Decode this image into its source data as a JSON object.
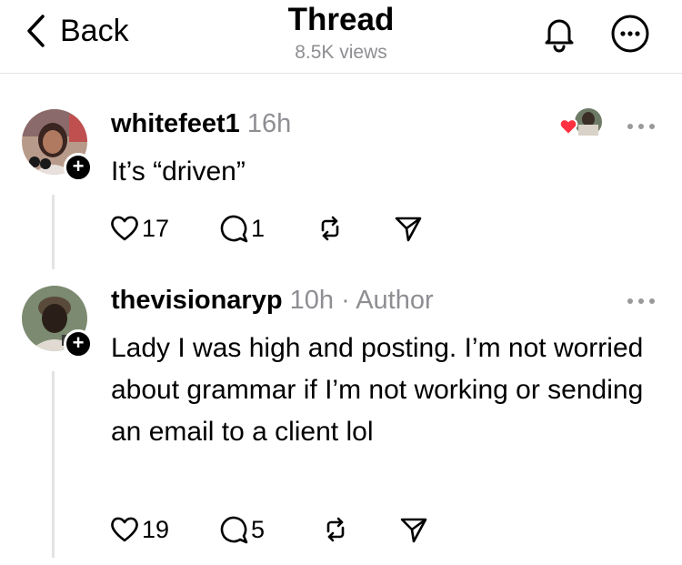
{
  "header": {
    "back_label": "Back",
    "title": "Thread",
    "views": "8.5K views"
  },
  "posts": [
    {
      "username": "whitefeet1",
      "time": "16h",
      "author_tag": "",
      "text": "It’s “driven”",
      "likes": "17",
      "replies": "1"
    },
    {
      "username": "thevisionaryp",
      "time": "10h",
      "author_tag": "· Author",
      "text": "Lady I was high and posting. I’m not worried about grammar if I’m not working or sending an email to a client lol",
      "likes": "19",
      "replies": "5"
    }
  ],
  "colors": {
    "heart": "#ff3040",
    "muted": "#8e8e93"
  },
  "icons": [
    "chevron-left-icon",
    "bell-icon",
    "more-circle-icon",
    "heart-icon",
    "comment-icon",
    "repost-icon",
    "send-icon",
    "more-dots-icon",
    "plus-icon"
  ]
}
